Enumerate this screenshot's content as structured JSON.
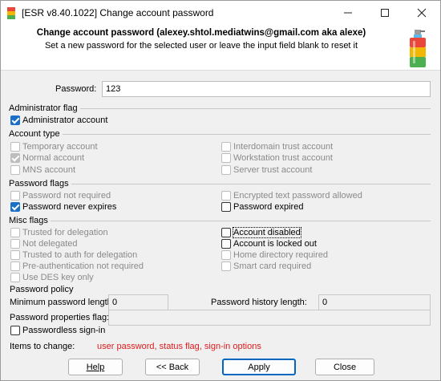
{
  "window": {
    "title": "[ESR v8.40.1022]  Change account password",
    "minimize_icon": "minimize-icon",
    "maximize_icon": "maximize-icon",
    "close_icon": "close-icon"
  },
  "header": {
    "title": "Change account password (alexey.shtol.mediatwins@gmail.com  aka  alexe)",
    "subtitle": "Set a new password for the selected user or leave the input field blank to reset it"
  },
  "password": {
    "label": "Password:",
    "value": "123"
  },
  "admin_flag": {
    "heading": "Administrator flag",
    "items": [
      {
        "label": "Administrator account",
        "checked": true,
        "disabled": false
      }
    ]
  },
  "account_type": {
    "heading": "Account type",
    "items": [
      {
        "label": "Temporary account",
        "checked": false,
        "disabled": true
      },
      {
        "label": "Normal account",
        "checked": true,
        "disabled": true
      },
      {
        "label": "MNS account",
        "checked": false,
        "disabled": true
      },
      {
        "label": "Interdomain trust account",
        "checked": false,
        "disabled": true
      },
      {
        "label": "Workstation trust account",
        "checked": false,
        "disabled": true
      },
      {
        "label": "Server trust account",
        "checked": false,
        "disabled": true
      }
    ]
  },
  "password_flags": {
    "heading": "Password flags",
    "items": [
      {
        "label": "Password not required",
        "checked": false,
        "disabled": true
      },
      {
        "label": "Password never expires",
        "checked": true,
        "disabled": false
      },
      {
        "label": "Encrypted text password allowed",
        "checked": false,
        "disabled": true
      },
      {
        "label": "Password expired",
        "checked": false,
        "disabled": false
      }
    ]
  },
  "misc_flags": {
    "heading": "Misc flags",
    "items": [
      {
        "label": "Trusted for delegation",
        "checked": false,
        "disabled": true
      },
      {
        "label": "Not delegated",
        "checked": false,
        "disabled": true
      },
      {
        "label": "Trusted to auth for delegation",
        "checked": false,
        "disabled": true
      },
      {
        "label": "Pre-authentication not required",
        "checked": false,
        "disabled": true
      },
      {
        "label": "Use DES key only",
        "checked": false,
        "disabled": true
      },
      {
        "label": "Account disabled",
        "checked": false,
        "disabled": false
      },
      {
        "label": "Account is locked out",
        "checked": false,
        "disabled": false
      },
      {
        "label": "Home directory required",
        "checked": false,
        "disabled": true
      },
      {
        "label": "Smart card required",
        "checked": false,
        "disabled": true
      }
    ]
  },
  "password_policy": {
    "heading": "Password policy",
    "min_length_label": "Minimum password length:",
    "min_length_value": "0",
    "history_length_label": "Password history length:",
    "history_length_value": "0",
    "properties_label": "Password properties flag:",
    "properties_value": ""
  },
  "passwordless": {
    "label": "Passwordless sign-in",
    "checked": false
  },
  "items_to_change": {
    "label": "Items to change:",
    "value": "user password, status flag, sign-in options",
    "value_color": "#e01b1b"
  },
  "buttons": {
    "help": "Help",
    "back": "<< Back",
    "apply": "Apply",
    "close": "Close"
  },
  "colors": {
    "accent": "#1a6fc9",
    "default_button_border": "#0067c0",
    "background": "#f0f0f0"
  }
}
